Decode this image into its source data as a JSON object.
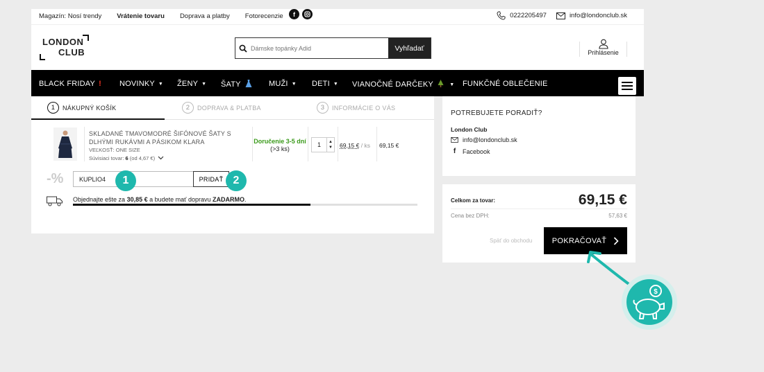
{
  "topbar": {
    "links": [
      "Magazín: Nosí trendy",
      "Vrátenie tovaru",
      "Doprava a platby",
      "Fotorecenzie"
    ],
    "phone": "0222205497",
    "email": "info@londonclub.sk",
    "social": [
      "facebook-icon",
      "instagram-icon"
    ]
  },
  "header": {
    "logo_line1": "LONDON",
    "logo_line2": "CLUB",
    "search_placeholder": "Dámske topánky Adid",
    "search_button": "Vyhľadať",
    "login_label": "Prihlásenie"
  },
  "nav": {
    "items": [
      {
        "label": "BLACK FRIDAY",
        "suffix": "❗"
      },
      {
        "label": "NOVINKY",
        "caret": "▼"
      },
      {
        "label": "ŽENY",
        "caret": "▼"
      },
      {
        "label": "ŠATY",
        "suffix": "👗"
      },
      {
        "label": "MUŽI",
        "caret": "▼"
      },
      {
        "label": "DETI",
        "caret": "▼"
      },
      {
        "label": "VIANOČNÉ DARČEKY",
        "suffix": "🎄",
        "caret": "▼"
      },
      {
        "label": "FUNKČNÉ OBLEČENIE"
      }
    ]
  },
  "steps": [
    {
      "num": "1",
      "label": "NÁKUPNÝ KOŠÍK"
    },
    {
      "num": "2",
      "label": "DOPRAVA & PLATBA"
    },
    {
      "num": "3",
      "label": "INFORMÁCIE O VÁS"
    }
  ],
  "cart": {
    "product_name": "SKLADANÉ TMAVOMODRÉ ŠIFÓNOVÉ ŠATY S DLHÝMI RUKÁVMI A PÁSIKOM KLARA",
    "size": "VEĽKOSŤ: ONE SIZE",
    "related_label": "Súvisiaci tovar:",
    "related_count": "6",
    "related_from": "(od 4,67 €)",
    "delivery_green": "Doručenie 3-5 dní",
    "delivery_stock": "(>3 ks)",
    "quantity": "1",
    "unit_price": "69,15 €",
    "unit_suffix": "/ ks",
    "line_total": "69,15 €"
  },
  "coupon": {
    "percent_sign": "-%",
    "value": "KUPLIO4",
    "button": "PRIDAŤ",
    "badge1": "1",
    "badge2": "2"
  },
  "shipping": {
    "text_before": "Objednajte ešte za ",
    "amount": "30,85 €",
    "text_middle": " a budete mať dopravu ",
    "free": "ZADARMO",
    "text_end": ".",
    "progress": 0.69
  },
  "advice": {
    "heading": "POTREBUJETE PORADIŤ?",
    "company": "London Club",
    "email": "info@londonclub.sk",
    "facebook": "Facebook"
  },
  "summary": {
    "total_label": "Celkom za tovar:",
    "total_value": "69,15 €",
    "net_label": "Cena bez DPH:",
    "net_value": "57,63 €",
    "back_link": "Späť do obchodu",
    "continue_button": "POKRAČOVAŤ"
  },
  "colors": {
    "accent": "#1fb8ad",
    "delivery_green": "#3a9a1a"
  }
}
